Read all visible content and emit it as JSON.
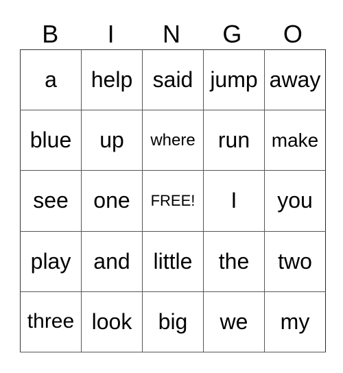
{
  "header": {
    "letters": [
      "B",
      "I",
      "N",
      "G",
      "O"
    ]
  },
  "card": {
    "rows": [
      [
        "a",
        "help",
        "said",
        "jump",
        "away"
      ],
      [
        "blue",
        "up",
        "where",
        "run",
        "make"
      ],
      [
        "see",
        "one",
        "FREE!",
        "I",
        "you"
      ],
      [
        "play",
        "and",
        "little",
        "the",
        "two"
      ],
      [
        "three",
        "look",
        "big",
        "we",
        "my"
      ]
    ]
  }
}
